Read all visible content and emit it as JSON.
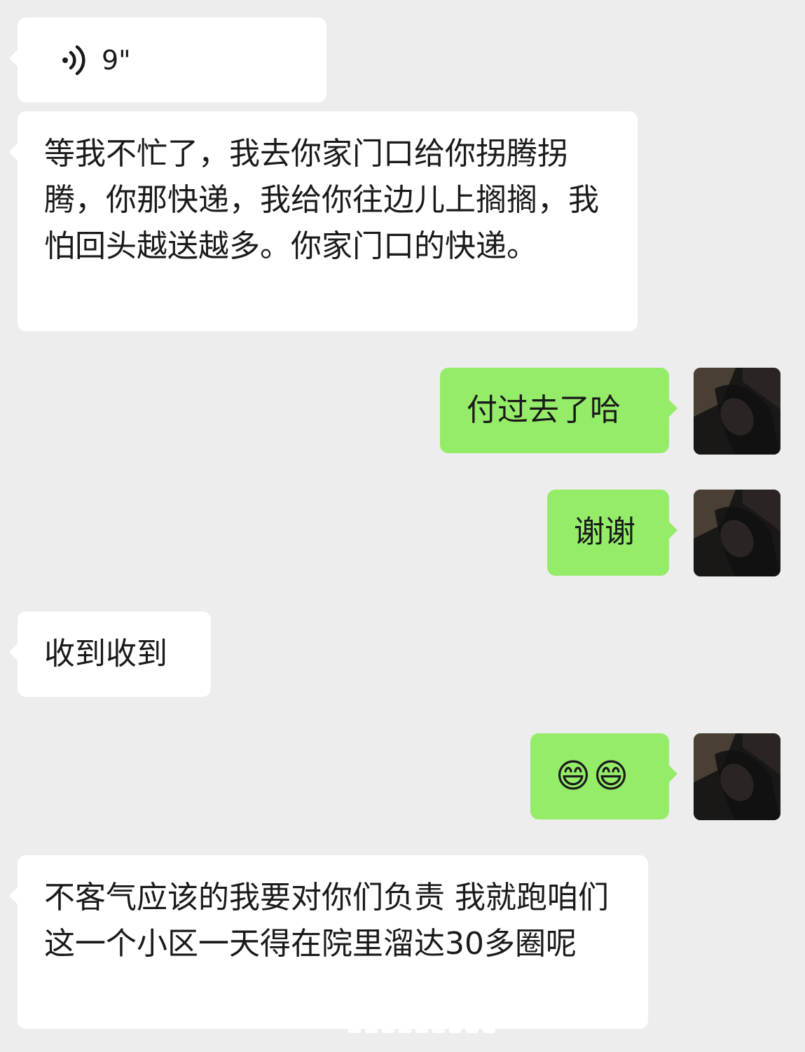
{
  "messages": [
    {
      "id": "m1",
      "side": "in",
      "kind": "voice",
      "duration": "9\""
    },
    {
      "id": "m2",
      "side": "in",
      "kind": "text",
      "text": "等我不忙了，我去你家门口给你拐腾拐腾，你那快递，我给你往边儿上搁搁，我怕回头越送越多。你家门口的快递。"
    },
    {
      "id": "m3",
      "side": "out",
      "kind": "text",
      "text": "付过去了哈"
    },
    {
      "id": "m4",
      "side": "out",
      "kind": "text",
      "text": "谢谢"
    },
    {
      "id": "m5",
      "side": "in",
      "kind": "text",
      "text": "收到收到"
    },
    {
      "id": "m6",
      "side": "out",
      "kind": "emoji",
      "emojis": [
        "😄",
        "😄"
      ]
    },
    {
      "id": "m7",
      "side": "in",
      "kind": "text",
      "text": "不客气应该的我要对你们负责 我就跑咱们这一个小区一天得在院里溜达30多圈呢"
    }
  ],
  "colors": {
    "background": "#ededed",
    "incoming_bubble": "#ffffff",
    "outgoing_bubble": "#95ec69"
  },
  "icons": {
    "voice": "voice-wave-icon",
    "avatar": "user-avatar"
  }
}
